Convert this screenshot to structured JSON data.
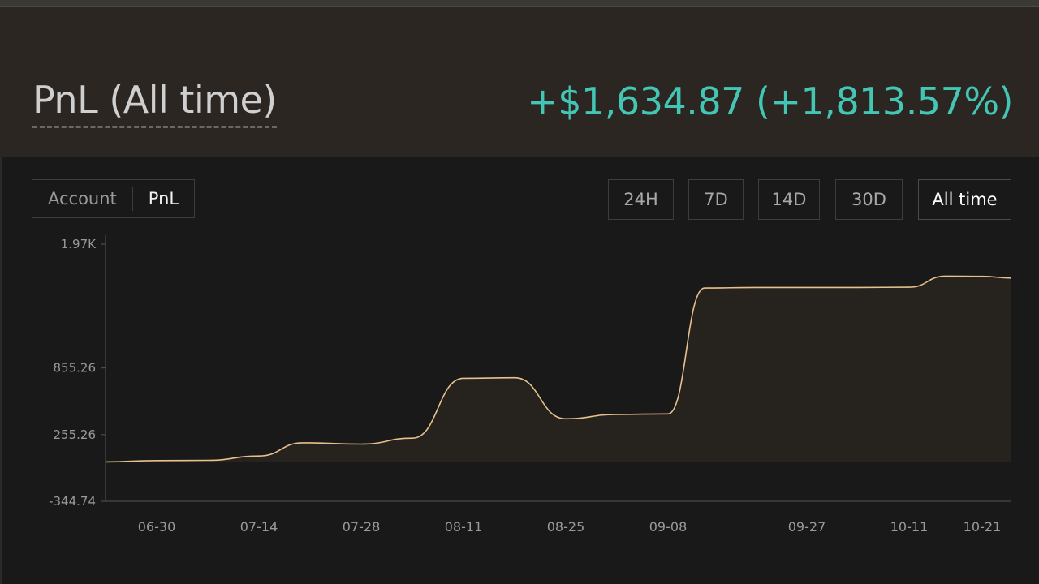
{
  "header": {
    "title": "PnL (All time)",
    "value": "+$1,634.87 (+1,813.57%)"
  },
  "view_toggle": {
    "items": [
      {
        "label": "Account",
        "active": false
      },
      {
        "label": "PnL",
        "active": true
      }
    ]
  },
  "ranges": [
    {
      "label": "24H",
      "active": false
    },
    {
      "label": "7D",
      "active": false
    },
    {
      "label": "14D",
      "active": false
    },
    {
      "label": "30D",
      "active": false
    },
    {
      "label": "All time",
      "active": true
    }
  ],
  "colors": {
    "positive": "#44c6b5",
    "line": "#e8c08c",
    "fill": "#26231f",
    "axis": "#555555"
  },
  "chart_data": {
    "type": "area",
    "title": "",
    "xlabel": "",
    "ylabel": "",
    "ylim": [
      -344.74,
      1970
    ],
    "y_tick_labels": [
      "1.97K",
      "855.26",
      "255.26",
      "-344.74"
    ],
    "y_tick_values": [
      1970,
      855.26,
      255.26,
      -344.74
    ],
    "x_tick_labels": [
      "06-30",
      "07-14",
      "07-28",
      "08-11",
      "08-25",
      "09-08",
      "09-27",
      "10-11",
      "10-21"
    ],
    "series": [
      {
        "x": [
          "06-23",
          "06-30",
          "07-07",
          "07-14",
          "07-20",
          "07-28",
          "08-04",
          "08-11",
          "08-18",
          "08-25",
          "09-01",
          "09-08",
          "09-13",
          "09-20",
          "09-27",
          "10-04",
          "10-11",
          "10-16",
          "10-21",
          "10-25"
        ],
        "values": [
          10,
          22,
          24,
          63,
          182,
          170,
          223,
          762,
          767,
          398,
          437,
          442,
          1575,
          1580,
          1580,
          1580,
          1582,
          1682,
          1680,
          1665
        ]
      }
    ],
    "grid": false,
    "legend": "none"
  }
}
